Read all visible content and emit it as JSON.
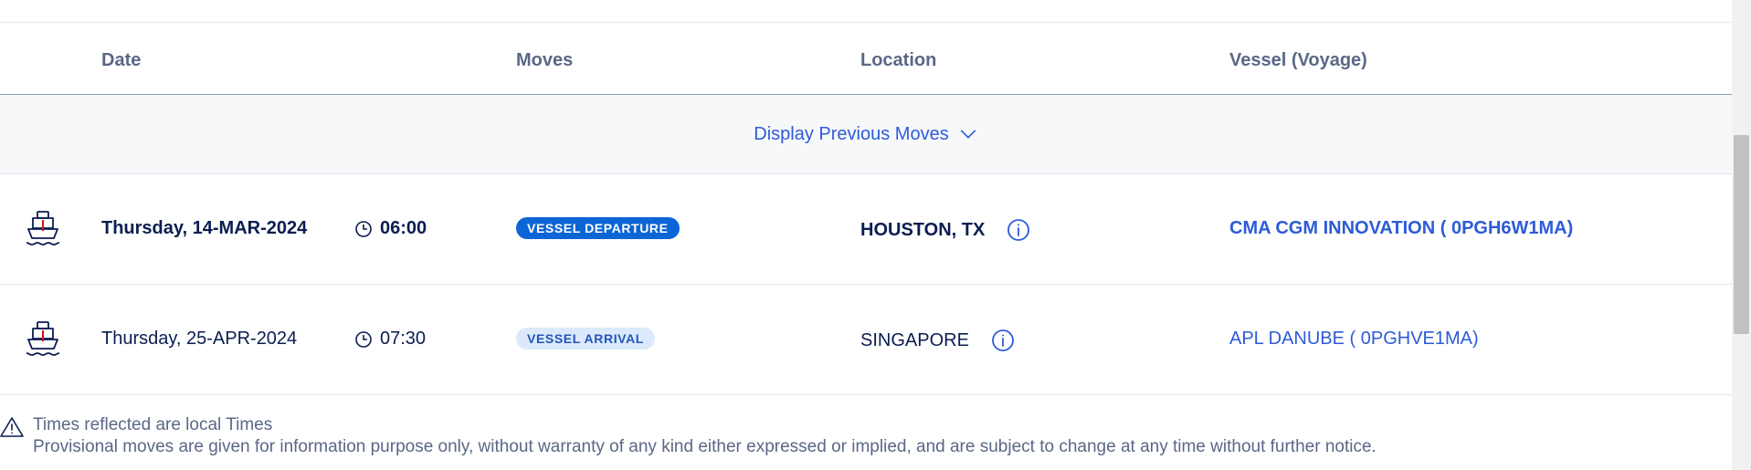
{
  "table": {
    "headers": {
      "date": "Date",
      "moves": "Moves",
      "location": "Location",
      "vessel": "Vessel (Voyage)"
    },
    "previous_moves_label": "Display Previous Moves",
    "rows": [
      {
        "date": "Thursday, 14-MAR-2024",
        "time": "06:00",
        "move": "VESSEL DEPARTURE",
        "location": "HOUSTON, TX",
        "vessel": "CMA CGM INNOVATION ( 0PGH6W1MA)"
      },
      {
        "date": "Thursday, 25-APR-2024",
        "time": "07:30",
        "move": "VESSEL ARRIVAL",
        "location": "SINGAPORE",
        "vessel": "APL DANUBE ( 0PGHVE1MA)"
      }
    ]
  },
  "notes": {
    "line1": "Times reflected are local Times",
    "line2": "Provisional moves are given for information purpose only, without warranty of any kind either expressed or implied, and are subject to change at any time without further notice."
  },
  "colors": {
    "link": "#2d5bd8",
    "departure_badge": "#0c65d4",
    "arrival_badge_bg": "#dbe9fb",
    "text_dark": "#0b1d51"
  },
  "icons": [
    "ship-icon",
    "clock-icon",
    "info-icon",
    "chevron-down-icon",
    "warning-icon"
  ]
}
